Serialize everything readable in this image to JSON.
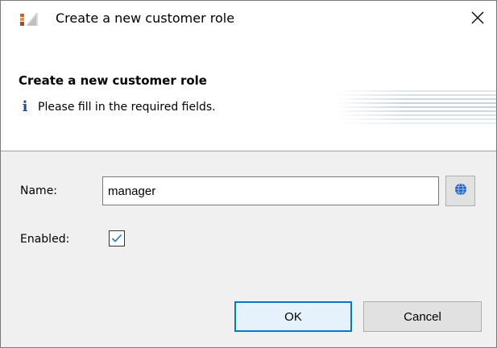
{
  "window": {
    "title": "Create a new customer role"
  },
  "banner": {
    "title": "Create a new customer role",
    "message": "Please fill in the required fields.",
    "info_icon": "i"
  },
  "form": {
    "name_label": "Name:",
    "name_value": "manager",
    "enabled_label": "Enabled:",
    "enabled_checked": true
  },
  "buttons": {
    "ok_label": "OK",
    "cancel_label": "Cancel"
  },
  "icons": {
    "app": "app-logo-icon",
    "close": "close-icon",
    "info": "info-icon",
    "globe": "globe-icon",
    "check": "checkmark-icon"
  },
  "colors": {
    "accent": "#0078d7",
    "info_icon": "#1f4e9c",
    "globe": "#1e5fbf",
    "checkmark": "#1a73c9"
  }
}
